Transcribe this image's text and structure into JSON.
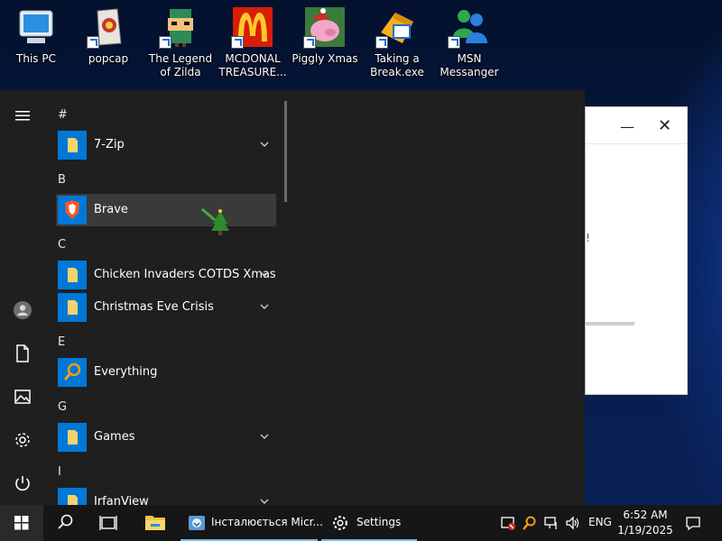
{
  "desktop": {
    "icons": [
      {
        "label": "This PC",
        "icon": "this-pc-icon"
      },
      {
        "label": "popcap",
        "icon": "popcap-icon"
      },
      {
        "label": "The Legend of Zilda",
        "icon": "legend-of-zilda-icon"
      },
      {
        "label": "MCDONAL TREASURE...",
        "icon": "mcdonalds-icon"
      },
      {
        "label": "Piggly Xmas",
        "icon": "piggly-xmas-icon"
      },
      {
        "label": "Taking a Break.exe",
        "icon": "taking-a-break-icon"
      },
      {
        "label": "MSN Messanger",
        "icon": "msn-messenger-icon"
      }
    ]
  },
  "background_window": {
    "minimize": "—",
    "close": "✕",
    "partial_text": "!"
  },
  "start_menu": {
    "rail": {
      "menu_icon": "hamburger-icon",
      "user_icon": "user-icon",
      "documents_icon": "documents-icon",
      "pictures_icon": "pictures-icon",
      "settings_icon": "gear-icon",
      "power_icon": "power-icon"
    },
    "groups": [
      {
        "header": "#",
        "items": [
          {
            "label": "7-Zip",
            "icon": "folder-icon",
            "expandable": true
          }
        ]
      },
      {
        "header": "B",
        "items": [
          {
            "label": "Brave",
            "icon": "brave-icon",
            "expandable": false,
            "selected": true
          }
        ]
      },
      {
        "header": "C",
        "items": [
          {
            "label": "Chicken Invaders COTDS Xmas",
            "icon": "folder-icon",
            "expandable": true
          },
          {
            "label": "Christmas Eve Crisis",
            "icon": "folder-icon",
            "expandable": true
          }
        ]
      },
      {
        "header": "E",
        "items": [
          {
            "label": "Everything",
            "icon": "search-magnifier-icon",
            "expandable": false
          }
        ]
      },
      {
        "header": "G",
        "items": [
          {
            "label": "Games",
            "icon": "folder-icon",
            "expandable": true
          }
        ]
      },
      {
        "header": "I",
        "items": [
          {
            "label": "IrfanView",
            "icon": "folder-icon",
            "expandable": true
          }
        ]
      }
    ]
  },
  "taskbar": {
    "tasks": [
      {
        "label": "",
        "icon": "search-icon"
      },
      {
        "label": "",
        "icon": "task-view-icon"
      },
      {
        "label": "",
        "icon": "file-explorer-icon"
      },
      {
        "label": "Інсталюється Micr...",
        "icon": "installer-icon"
      },
      {
        "label": "Settings",
        "icon": "gear-icon"
      }
    ],
    "tray": {
      "language": "ENG",
      "time": "6:52 AM",
      "date": "1/19/2025"
    }
  },
  "colors": {
    "accent": "#0078d7",
    "start_bg": "#1f1f1f",
    "taskbar_bg": "#161616",
    "selection": "#3a3a3a"
  }
}
